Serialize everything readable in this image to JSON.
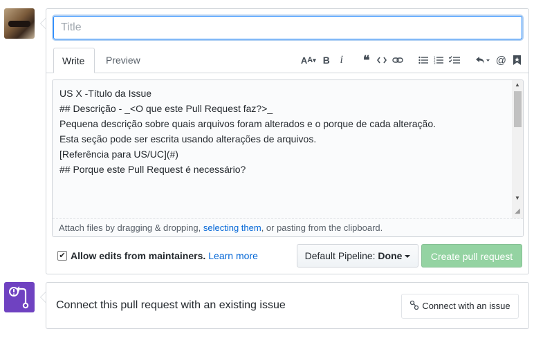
{
  "composer": {
    "title_placeholder": "Title",
    "title_value": "",
    "tabs": [
      {
        "label": "Write",
        "active": true
      },
      {
        "label": "Preview",
        "active": false
      }
    ],
    "toolbar": [
      {
        "icon": "text-size-icon",
        "glyph": "AA▾"
      },
      {
        "icon": "bold-icon",
        "glyph": "B"
      },
      {
        "icon": "italic-icon",
        "glyph": "i"
      },
      {
        "icon": "quote-icon",
        "glyph": "❝"
      },
      {
        "icon": "code-icon",
        "glyph": "<>"
      },
      {
        "icon": "link-icon",
        "glyph": "⊝"
      },
      {
        "icon": "unordered-list-icon",
        "glyph": "☰"
      },
      {
        "icon": "ordered-list-icon",
        "glyph": "☷"
      },
      {
        "icon": "task-list-icon",
        "glyph": "☑"
      },
      {
        "icon": "reply-icon",
        "glyph": "↶▾"
      },
      {
        "icon": "mention-icon",
        "glyph": "@"
      },
      {
        "icon": "bookmark-icon",
        "glyph": "⛉"
      }
    ],
    "body_lines": [
      "US X -Título da Issue",
      "",
      "## Descrição - _<O que este Pull Request faz?>_",
      "Pequena descrição sobre quais arquivos foram alterados e o porque de cada alteração.",
      "Esta seção pode ser escrita usando alterações de arquivos.",
      "",
      "[Referência para US/UC](#)",
      "",
      "## Porque este Pull Request é necessário?"
    ],
    "attach": {
      "prefix": "Attach files by dragging & dropping, ",
      "link": "selecting them",
      "suffix": ", or pasting from the clipboard."
    },
    "allow_edits": {
      "checked": true,
      "label": "Allow edits from maintainers.",
      "learn_more": "Learn more"
    },
    "pipeline": {
      "prefix": "Default Pipeline: ",
      "value": "Done"
    },
    "create_button": "Create pull request"
  },
  "connect": {
    "text": "Connect this pull request with an existing issue",
    "button": "Connect with an issue"
  },
  "colors": {
    "accent": "#0366d6",
    "create_button_bg": "#94d3a2",
    "pr_icon_bg": "#6f42c1"
  }
}
